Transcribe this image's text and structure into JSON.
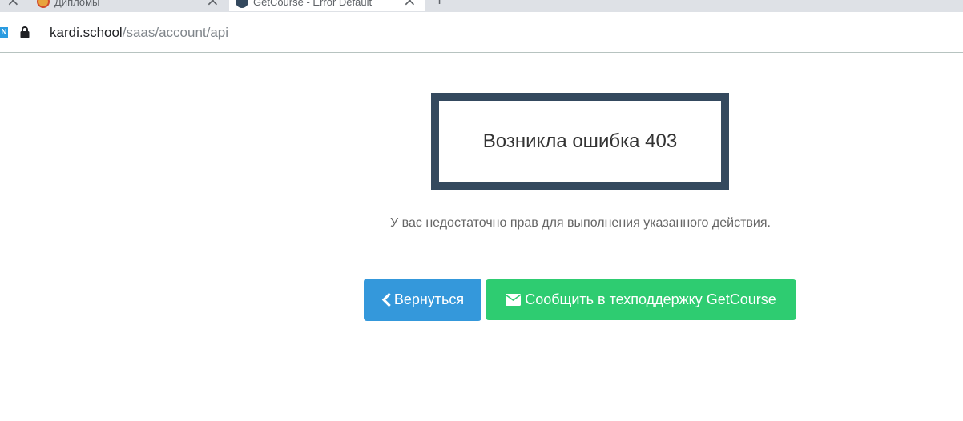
{
  "browser": {
    "tabs": [
      {
        "title": "Дипломы",
        "active": false
      },
      {
        "title": "GetCourse - Error Default",
        "active": true
      }
    ],
    "extension_label": "N",
    "url_host": "kardi.school",
    "url_path": "/saas/account/api"
  },
  "error": {
    "title": "Возникла ошибка 403",
    "message": "У вас недостаточно прав для выполнения указанного действия."
  },
  "buttons": {
    "back_label": "Вернуться",
    "back_icon": "chevron-left-icon",
    "support_label": "Сообщить в техподдержку GetCourse",
    "support_icon": "envelope-icon"
  },
  "colors": {
    "box_border": "#34495e",
    "back_button": "#3498db",
    "support_button": "#2ecc71"
  }
}
